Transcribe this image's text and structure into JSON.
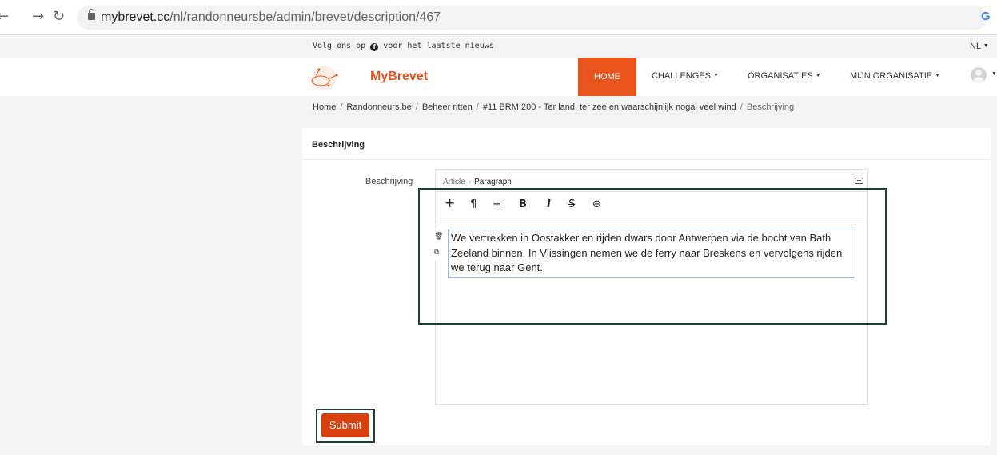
{
  "browser": {
    "back_icon": "arrow-left",
    "forward_icon": "arrow-right",
    "reload_icon": "reload",
    "url_host": "mybrevet.cc",
    "url_path": "/nl/randonneursbe/admin/brevet/description/467",
    "google_icon": "G"
  },
  "topbar": {
    "follow_prefix": "Volg ons op",
    "follow_suffix": "voor het laatste nieuws",
    "social_icon": "f",
    "language": "NL"
  },
  "header": {
    "brand": "MyBrevet",
    "nav": [
      {
        "label": "HOME",
        "active": true
      },
      {
        "label": "CHALLENGES",
        "dropdown": true
      },
      {
        "label": "ORGANISATIES",
        "dropdown": true
      },
      {
        "label": "MIJN ORGANISATIE",
        "dropdown": true
      }
    ],
    "accent_color": "#e8541c"
  },
  "breadcrumb": {
    "items": [
      "Home",
      "Randonneurs.be",
      "Beheer ritten",
      "#11 BRM 200 - Ter land, ter zee en waarschijnlijk nogal veel wind",
      "Beschrijving"
    ]
  },
  "card": {
    "title": "Beschrijving",
    "field_label": "Beschrijving",
    "editor": {
      "crumb": [
        "Article",
        "Paragraph"
      ],
      "toolbar": [
        {
          "name": "add-icon",
          "glyph": "+"
        },
        {
          "name": "paragraph-icon",
          "glyph": "¶"
        },
        {
          "name": "align-icon",
          "glyph": "≡"
        },
        {
          "name": "bold-icon",
          "glyph": "B"
        },
        {
          "name": "italic-icon",
          "glyph": "I"
        },
        {
          "name": "strikethrough-icon",
          "glyph": "S"
        },
        {
          "name": "link-icon",
          "glyph": "⊖"
        }
      ],
      "content": "We vertrekken in Oostakker en rijden dwars door Antwerpen via de bocht van Bath Zeeland binnen. In Vlissingen nemen we de ferry naar Breskens en vervolgens rijden we terug naar Gent."
    },
    "submit_label": "Submit",
    "submit_color": "#d8400e"
  }
}
